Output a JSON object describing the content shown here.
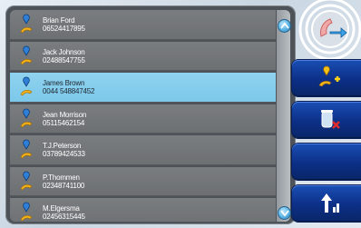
{
  "contacts": [
    {
      "name": "Brian Ford",
      "number": "06524417895"
    },
    {
      "name": "Jack Johnson",
      "number": "02488547755"
    },
    {
      "name": "James Brown",
      "number": "0044 548847452",
      "selected": true
    },
    {
      "name": "Jean Morrison",
      "number": "05115462154"
    },
    {
      "name": "T.J.Peterson",
      "number": "03789424533"
    },
    {
      "name": "P.Thommen",
      "number": "02348741100"
    },
    {
      "name": "M.Elgersma",
      "number": "02456315445"
    }
  ],
  "icons": {
    "contact": "phone-handset-pin-icon",
    "scroll_up": "chevron-up-icon",
    "scroll_down": "chevron-down-icon",
    "call": "phone-call-icon",
    "add": "add-contact-icon",
    "delete": "delete-trash-icon",
    "sort": "sort-ascending-icon"
  },
  "colors": {
    "selected_row": "#7cc8ea",
    "row": "#707376",
    "button": "#0e3a9a",
    "call_ring": "#ffffff",
    "handset": "#f0a8a8"
  }
}
